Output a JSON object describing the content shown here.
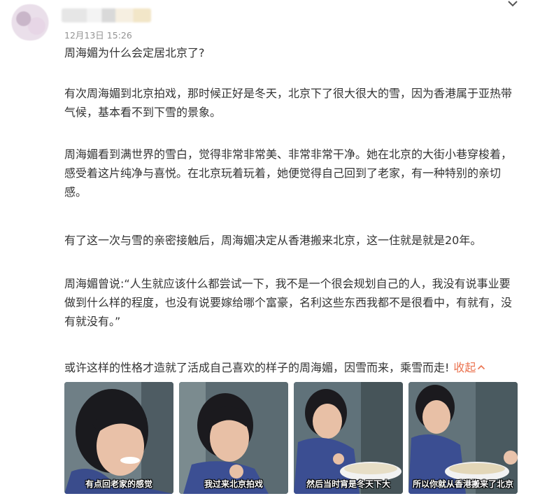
{
  "post": {
    "timestamp": "12月13日 15:26",
    "paragraphs": [
      "周海媚为什么会定居北京了?",
      "有次周海媚到北京拍戏，那时候正好是冬天，北京下了很大很大的雪，因为香港属于亚热带气候，基本看不到下雪的景象。",
      "周海媚看到满世界的雪白，觉得非常非常美、非常非常干净。她在北京的大街小巷穿梭着，感受着这片纯净与喜悦。在北京玩着玩着，她便觉得自己回到了老家，有一种特别的亲切感。",
      "有了这一次与雪的亲密接触后，周海媚决定从香港搬来北京，这一住就是就是20年。",
      "周海媚曾说:“人生就应该什么都尝试一下，我不是一个很会规划自己的人，我没有说事业要做到什么样的程度，也没有说要嫁给哪个富豪，名利这些东西我都不是很看中，有就有，没有就没有。”",
      "或许这样的性格才造就了活成自己喜欢的样子的周海媚，因雪而来，乘雪而走!"
    ],
    "collapse_label": "收起",
    "icons": {
      "menu": "chevron-down-icon",
      "collapse": "chevron-up-icon"
    }
  },
  "images": [
    {
      "caption": "有点回老家的感觉"
    },
    {
      "caption": "我过来北京拍戏"
    },
    {
      "caption": "然后当时宵是冬天下大"
    },
    {
      "caption": "所以你就从香港搬来了北京"
    }
  ],
  "colors": {
    "accent": "#eb7350",
    "meta": "#939393",
    "text": "#333333"
  }
}
